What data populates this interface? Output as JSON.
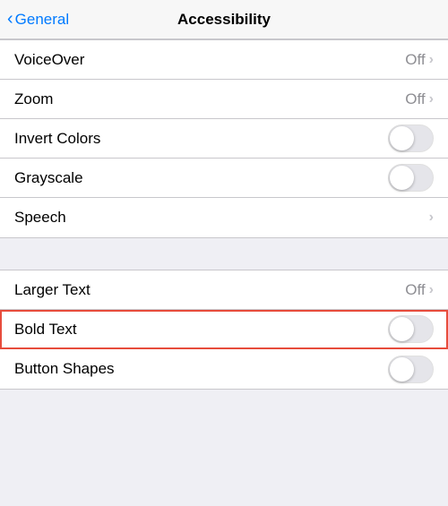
{
  "header": {
    "title": "Accessibility",
    "back_label": "General"
  },
  "group1": {
    "items": [
      {
        "id": "voiceover",
        "label": "VoiceOver",
        "type": "navigation",
        "value": "Off"
      },
      {
        "id": "zoom",
        "label": "Zoom",
        "type": "navigation",
        "value": "Off"
      },
      {
        "id": "invert-colors",
        "label": "Invert Colors",
        "type": "toggle",
        "value": false
      },
      {
        "id": "grayscale",
        "label": "Grayscale",
        "type": "toggle",
        "value": false
      },
      {
        "id": "speech",
        "label": "Speech",
        "type": "navigation",
        "value": ""
      }
    ]
  },
  "group2": {
    "items": [
      {
        "id": "larger-text",
        "label": "Larger Text",
        "type": "navigation",
        "value": "Off"
      },
      {
        "id": "bold-text",
        "label": "Bold Text",
        "type": "toggle",
        "value": false,
        "highlighted": true
      },
      {
        "id": "button-shapes",
        "label": "Button Shapes",
        "type": "toggle",
        "value": false
      }
    ]
  },
  "icons": {
    "chevron_right": "›",
    "chevron_left": "‹"
  }
}
